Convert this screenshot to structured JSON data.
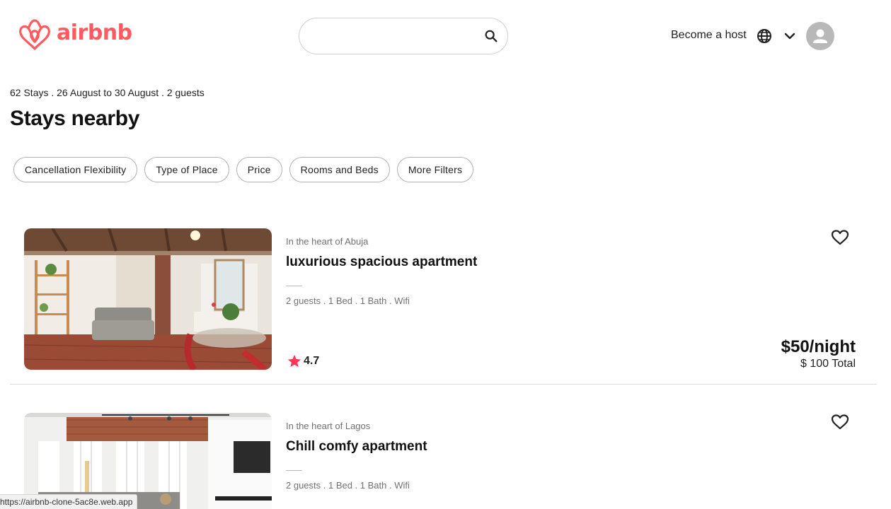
{
  "header": {
    "logo_text": "airbnb",
    "search": {
      "placeholder": "",
      "value": ""
    },
    "become_host_label": "Become a host",
    "icons": [
      "airbnb-logo-icon",
      "search-icon",
      "globe-icon",
      "chevron-down-icon",
      "user-avatar-icon"
    ]
  },
  "summary": {
    "text": "62 Stays . 26 August to 30 August . 2 guests",
    "title": "Stays nearby"
  },
  "filters": [
    {
      "label": "Cancellation Flexibility"
    },
    {
      "label": "Type of Place"
    },
    {
      "label": "Price"
    },
    {
      "label": "Rooms and Beds"
    },
    {
      "label": "More Filters"
    }
  ],
  "listings": [
    {
      "location": "In the heart of Abuja",
      "title": "luxurious spacious apartment",
      "amenities": "2 guests . 1 Bed . 1 Bath . Wifi",
      "rating": "4.7",
      "price": "$50/night",
      "total": "$ 100 Total"
    },
    {
      "location": "In the heart of Lagos",
      "title": "Chill comfy apartment",
      "amenities": "2 guests . 1 Bed . 1 Bath . Wifi"
    }
  ],
  "status_bar": {
    "url": "https://airbnb-clone-5ac8e.web.app"
  },
  "colors": {
    "brand": "#ff5a5f",
    "star": "#ff385c",
    "text": "#222222",
    "muted": "#717171"
  }
}
